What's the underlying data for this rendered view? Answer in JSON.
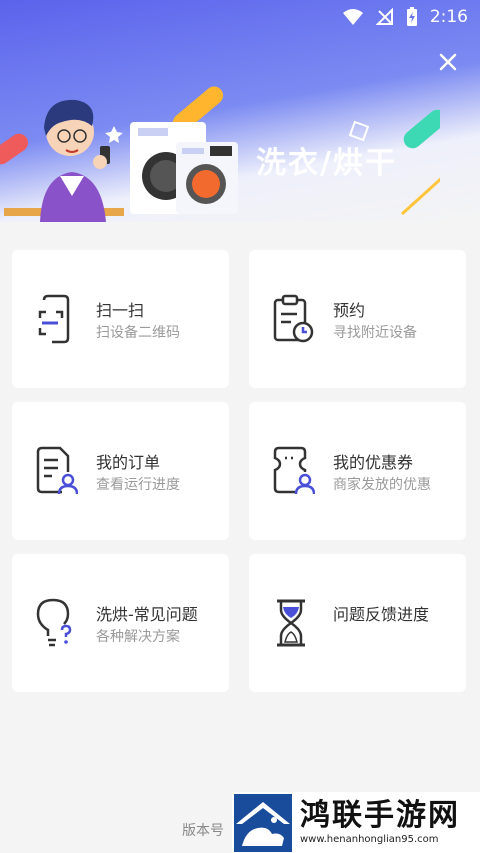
{
  "status_bar": {
    "time": "2:16"
  },
  "banner": {
    "title": "洗衣/烘干"
  },
  "cards": [
    {
      "title": "扫一扫",
      "subtitle": "扫设备二维码",
      "icon": "scan-phone-icon"
    },
    {
      "title": "预约",
      "subtitle": "寻找附近设备",
      "icon": "clipboard-clock-icon"
    },
    {
      "title": "我的订单",
      "subtitle": "查看运行进度",
      "icon": "order-list-icon"
    },
    {
      "title": "我的优惠券",
      "subtitle": "商家发放的优惠",
      "icon": "coupon-user-icon"
    },
    {
      "title": "洗烘-常见问题",
      "subtitle": "各种解决方案",
      "icon": "lightbulb-question-icon"
    },
    {
      "title": "问题反馈进度",
      "subtitle": "",
      "icon": "hourglass-icon"
    }
  ],
  "footer": {
    "version": "版本号"
  },
  "watermark": {
    "title": "鸿联手游网",
    "url": "www.henanhonglian95.com"
  },
  "colors": {
    "accent": "#4a4fd8",
    "icon_dark": "#333333",
    "banner": "#5b63ec"
  }
}
